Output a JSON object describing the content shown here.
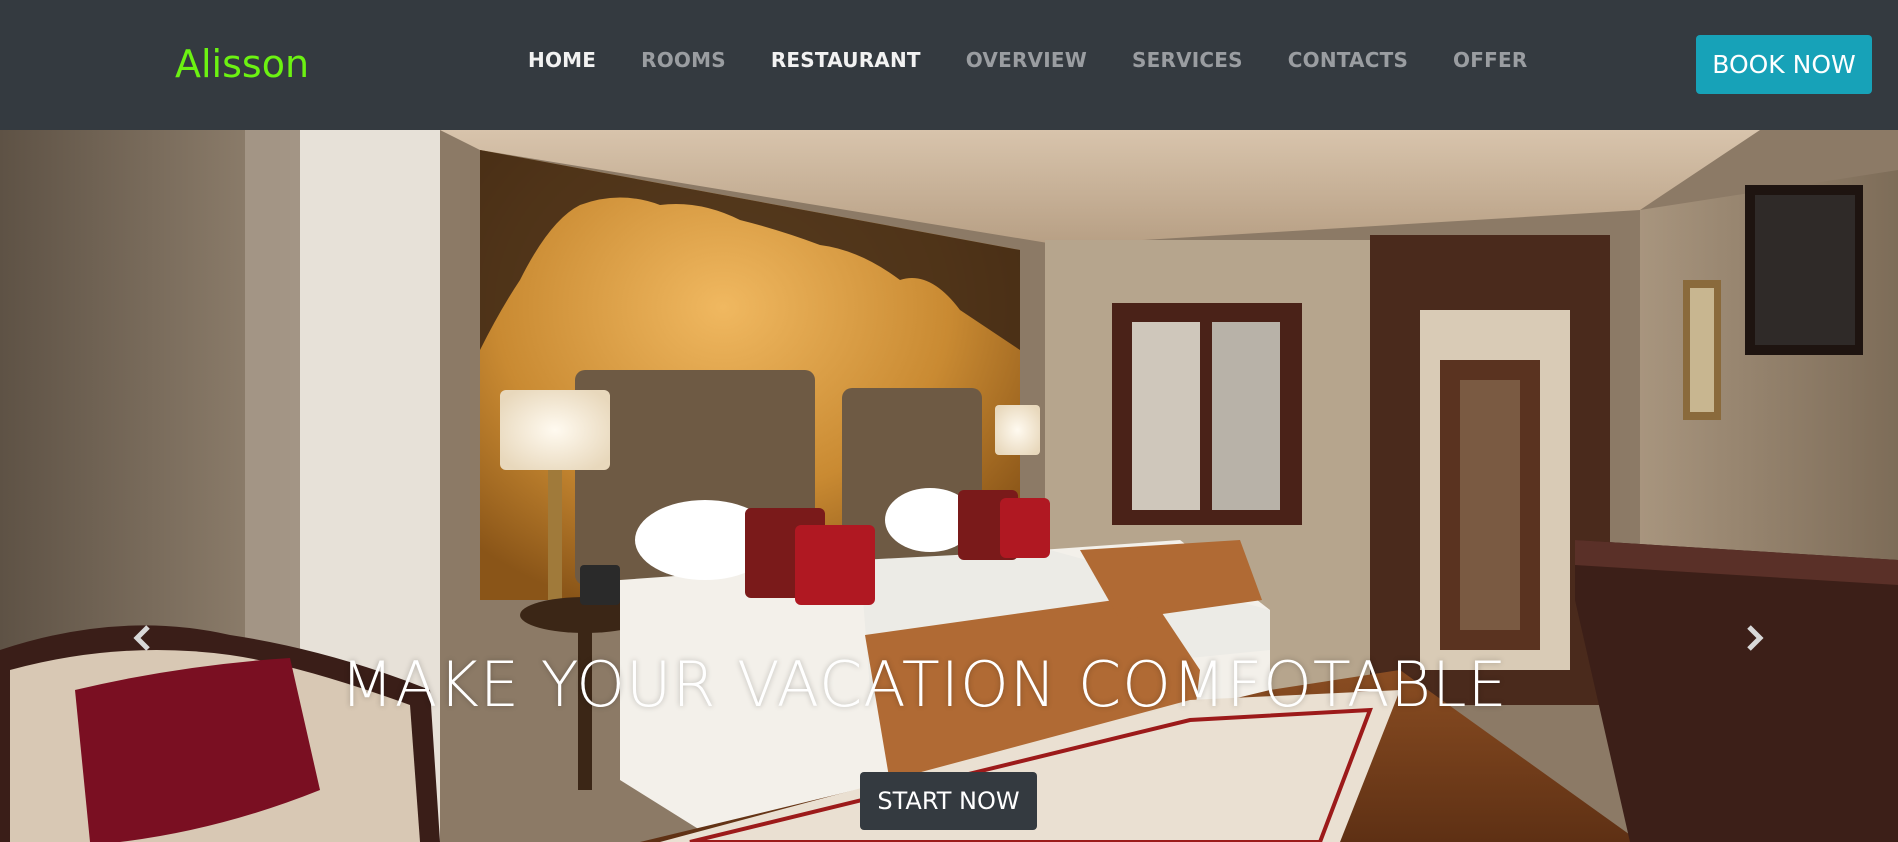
{
  "navbar": {
    "brand": "Alisson",
    "items": [
      {
        "label": "HOME",
        "active": true
      },
      {
        "label": "ROOMS",
        "active": false
      },
      {
        "label": "RESTAURANT",
        "active": true
      },
      {
        "label": "OVERVIEW",
        "active": false
      },
      {
        "label": "SERVICES",
        "active": false
      },
      {
        "label": "CONTACTS",
        "active": false
      },
      {
        "label": "OFFER",
        "active": false
      }
    ],
    "book_button": "BOOK NOW"
  },
  "hero": {
    "caption": "MAKE YOUR VACATION COMFOTABLE",
    "cta": "START NOW",
    "prev_icon": "chevron-left-icon",
    "next_icon": "chevron-right-icon",
    "image": "hotel-room-photo"
  },
  "colors": {
    "navbar_bg": "#343a40",
    "brand": "#6cf212",
    "book_button": "#17a2b8",
    "nav_muted": "#9a9da1",
    "nav_bright": "#f2f2f2"
  }
}
